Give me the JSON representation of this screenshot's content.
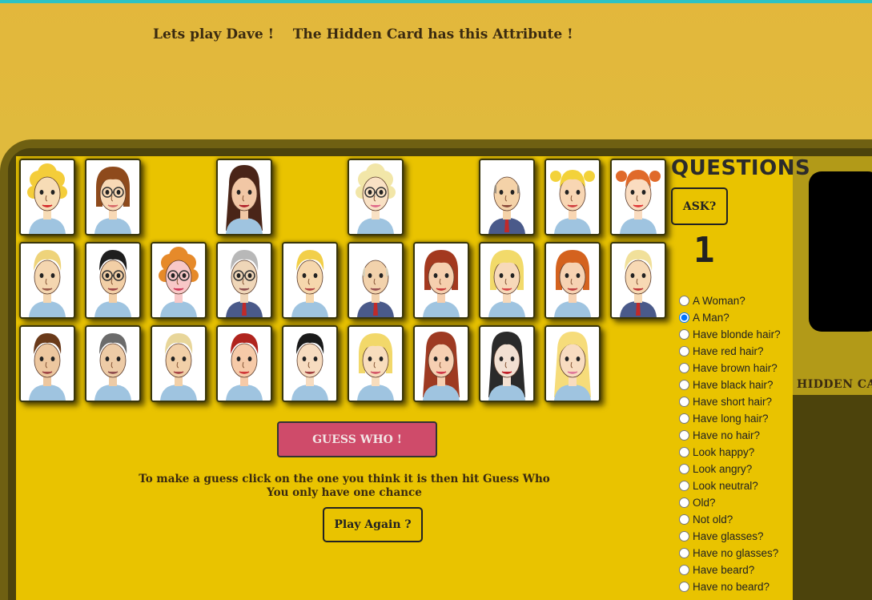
{
  "header": {
    "title": "Lets play Dave !    The Hidden Card has this Attribute !"
  },
  "board": {
    "cards": [
      {
        "name": "card-blonde-curly-woman",
        "skin": "#f7dcb6",
        "hair": "#f4cd3a",
        "lips": "#d42a2a",
        "style": "curly",
        "row": 0,
        "col": 0
      },
      {
        "name": "card-brown-bob-glasses-woman",
        "skin": "#f8d9b6",
        "hair": "#8e4a1c",
        "lips": "#d86a6a",
        "style": "bob",
        "glasses": true,
        "row": 0,
        "col": 1
      },
      {
        "name": "card-long-dark-hair-woman",
        "skin": "#f1c7a5",
        "hair": "#4a2518",
        "lips": "#b0202a",
        "style": "long",
        "row": 0,
        "col": 3
      },
      {
        "name": "card-blonde-glasses-woman",
        "skin": "#f9e1c4",
        "hair": "#f2e6a8",
        "lips": "#e06a8a",
        "style": "curly",
        "glasses": true,
        "row": 0,
        "col": 5
      },
      {
        "name": "card-bald-old-man",
        "skin": "#f4d2a8",
        "hair": "#9a8f80",
        "lips": "#8a4a3a",
        "style": "bald",
        "suit": true,
        "row": 0,
        "col": 7
      },
      {
        "name": "card-blonde-pigtails-girl",
        "skin": "#f8d6b3",
        "hair": "#f3d23a",
        "lips": "#d04040",
        "style": "pigtails",
        "row": 0,
        "col": 8
      },
      {
        "name": "card-red-hair-girl",
        "skin": "#fadcc0",
        "hair": "#e06a2a",
        "lips": "#e03a3a",
        "style": "pigtails",
        "row": 0,
        "col": 9
      },
      {
        "name": "card-blonde-spiky-man",
        "skin": "#f4d6b0",
        "hair": "#eed37a",
        "lips": "#9a5a4a",
        "style": "short",
        "row": 1,
        "col": 0
      },
      {
        "name": "card-sunglasses-man",
        "skin": "#f2cfa6",
        "hair": "#1e1e1e",
        "lips": "#a04848",
        "style": "short",
        "glasses": true,
        "row": 1,
        "col": 1
      },
      {
        "name": "card-curly-orange-woman",
        "skin": "#f8c8c8",
        "hair": "#e68a2a",
        "lips": "#d03a5a",
        "style": "curly",
        "glasses": true,
        "row": 1,
        "col": 2
      },
      {
        "name": "card-grey-glasses-old-man",
        "skin": "#efd6b8",
        "hair": "#b8b8b8",
        "lips": "#905050",
        "style": "short",
        "glasses": true,
        "suit": true,
        "row": 1,
        "col": 3
      },
      {
        "name": "card-blonde-smiling-man",
        "skin": "#f6d7ad",
        "hair": "#f2cf4a",
        "lips": "#b44848",
        "style": "short",
        "row": 1,
        "col": 4
      },
      {
        "name": "card-balding-suit-man",
        "skin": "#f2d2ac",
        "hair": "#d8d0b8",
        "lips": "#985050",
        "style": "bald",
        "suit": true,
        "row": 1,
        "col": 5
      },
      {
        "name": "card-auburn-bob-woman",
        "skin": "#f6cfae",
        "hair": "#a3391f",
        "lips": "#c83a3a",
        "style": "bob",
        "row": 1,
        "col": 6
      },
      {
        "name": "card-blonde-bob-woman",
        "skin": "#f7d9b9",
        "hair": "#f2da6a",
        "lips": "#d84848",
        "style": "bob",
        "row": 1,
        "col": 7
      },
      {
        "name": "card-ginger-worried-woman",
        "skin": "#f6d2b2",
        "hair": "#d4621e",
        "lips": "#c04040",
        "style": "bob",
        "row": 1,
        "col": 8
      },
      {
        "name": "card-blonde-quiff-man",
        "skin": "#f7d9b4",
        "hair": "#f1e09a",
        "lips": "#c03838",
        "style": "short",
        "suit": true,
        "row": 1,
        "col": 9
      },
      {
        "name": "card-brown-hair-man",
        "skin": "#edc79f",
        "hair": "#6a3a1a",
        "lips": "#a04848",
        "style": "short",
        "row": 2,
        "col": 0
      },
      {
        "name": "card-grey-hair-man",
        "skin": "#edcba6",
        "hair": "#6b6b6b",
        "lips": "#905050",
        "style": "short",
        "row": 2,
        "col": 1
      },
      {
        "name": "card-blonde-surprised-man",
        "skin": "#f2d0a8",
        "hair": "#e8d69a",
        "lips": "#a84848",
        "style": "short",
        "row": 2,
        "col": 2
      },
      {
        "name": "card-red-hair-laughing-man",
        "skin": "#f6caa8",
        "hair": "#b0241e",
        "lips": "#d03a3a",
        "style": "short",
        "row": 2,
        "col": 3
      },
      {
        "name": "card-dark-quiff-man",
        "skin": "#f7dcc0",
        "hair": "#1a1a1a",
        "lips": "#a04040",
        "style": "short",
        "row": 2,
        "col": 4
      },
      {
        "name": "card-blonde-tired-woman",
        "skin": "#f8ddbd",
        "hair": "#f2d86a",
        "lips": "#d45a6a",
        "style": "bob",
        "row": 2,
        "col": 5
      },
      {
        "name": "card-auburn-sideswept-woman",
        "skin": "#f6cfb2",
        "hair": "#9e3a22",
        "lips": "#d03848",
        "style": "long",
        "row": 2,
        "col": 6
      },
      {
        "name": "card-black-hair-goth-woman",
        "skin": "#f2e0d2",
        "hair": "#2a2a2a",
        "lips": "#c0202a",
        "style": "long",
        "row": 2,
        "col": 7
      },
      {
        "name": "card-long-blonde-woman",
        "skin": "#f8dcc0",
        "hair": "#f6dc7a",
        "lips": "#e07a9a",
        "style": "long",
        "row": 2,
        "col": 8
      }
    ],
    "guess_label": "GUESS WHO !",
    "instructions_line1": "To make a guess click on the one you think it is then hit Guess Who",
    "instructions_line2": "You only have one chance",
    "play_again_label": "Play Again ?"
  },
  "questions": {
    "title": "QUESTIONS",
    "ask_label": "ASK?",
    "count": "1",
    "selected_index": 1,
    "items": [
      "A Woman?",
      "A Man?",
      "Have blonde hair?",
      "Have red hair?",
      "Have brown hair?",
      "Have black hair?",
      "Have short hair?",
      "Have long hair?",
      "Have no hair?",
      "Look happy?",
      "Look angry?",
      "Look neutral?",
      "Old?",
      "Not old?",
      "Have glasses?",
      "Have no glasses?",
      "Have beard?",
      "Have no beard?"
    ]
  },
  "hidden": {
    "label": "HIDDEN CARD"
  }
}
